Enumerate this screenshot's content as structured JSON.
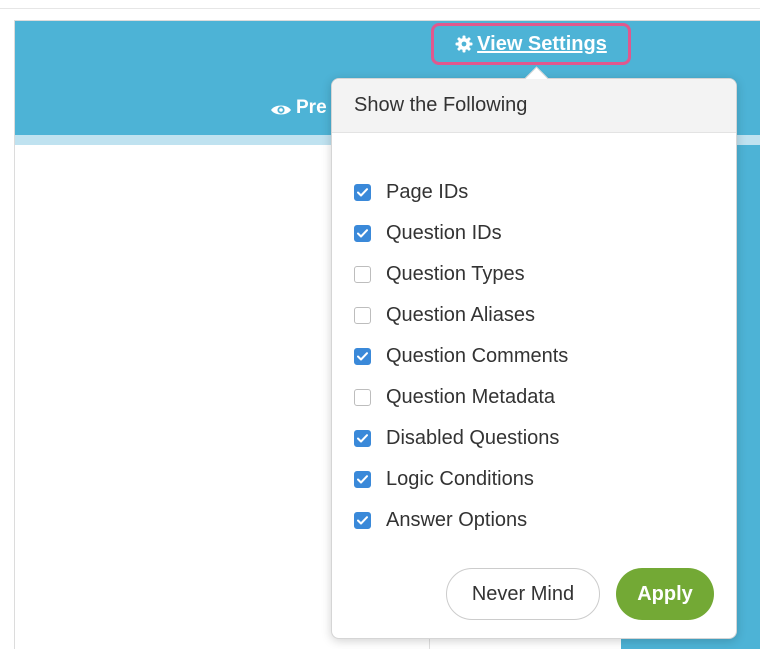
{
  "header": {
    "view_settings_label": "View Settings",
    "preview_label": "Pre"
  },
  "popover": {
    "title": "Show the Following",
    "options": [
      {
        "label": "Page IDs",
        "checked": true
      },
      {
        "label": "Question IDs",
        "checked": true
      },
      {
        "label": "Question Types",
        "checked": false
      },
      {
        "label": "Question Aliases",
        "checked": false
      },
      {
        "label": "Question Comments",
        "checked": true
      },
      {
        "label": "Question Metadata",
        "checked": false
      },
      {
        "label": "Disabled Questions",
        "checked": true
      },
      {
        "label": "Logic Conditions",
        "checked": true
      },
      {
        "label": "Answer Options",
        "checked": true
      }
    ],
    "cancel_label": "Never Mind",
    "apply_label": "Apply"
  },
  "colors": {
    "header_blue": "#4db3d6",
    "highlight_pink": "#e0588e",
    "checkbox_blue": "#3a89d9",
    "apply_green": "#73a935"
  },
  "icons": {
    "view_settings": "gear-icon",
    "preview": "eye-icon",
    "checked": "checkmark-icon"
  }
}
